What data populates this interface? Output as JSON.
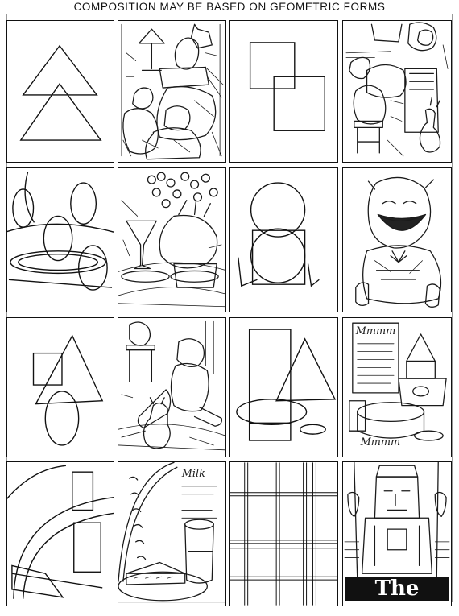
{
  "title": "COMPOSITION MAY BE BASED ON GEOMETRIC FORMS",
  "labels": {
    "milk": "Milk",
    "memo_top": "Mmmm",
    "memo_bottom": "Mmmm",
    "chief": "The Chief"
  },
  "icons": {
    "two-triangles": "triangle",
    "two-squares": "square",
    "circles": "circle",
    "stacked-circles": "circle",
    "triangle-square-oval": "triangle",
    "rect-triangle-ellipse": "rectangle",
    "arcs-rects": "arc",
    "plaid-grid": "grid"
  }
}
